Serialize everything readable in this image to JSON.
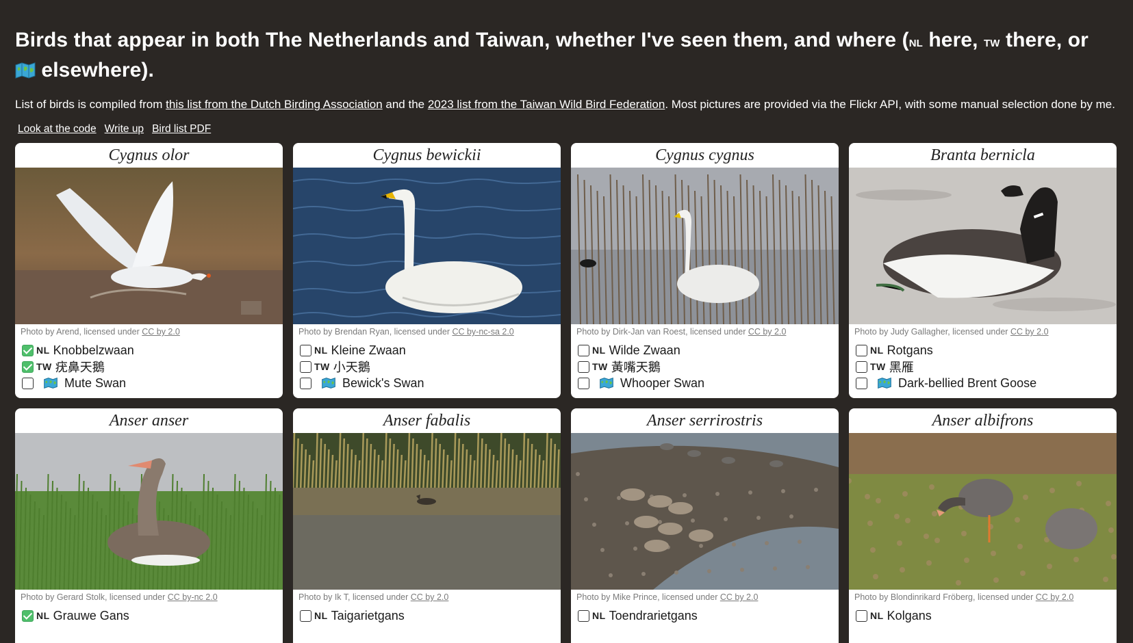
{
  "header": {
    "title_part1": "Birds that appear in both The Netherlands and Taiwan, whether I've seen them, and where (",
    "nl_tag": "NL",
    "title_part2": " here, ",
    "tw_tag": "TW",
    "title_part3": " there, or",
    "title_part4": " elsewhere)."
  },
  "intro": {
    "t1": "List of birds is compiled from ",
    "link1": "this list from the Dutch Birding Association",
    "t2": " and the ",
    "link2": "2023 list from the Taiwan Wild Bird Federation",
    "t3": ". Most pictures are provided via the Flickr API, with some manual selection done by me."
  },
  "links": {
    "code": "Look at the code",
    "writeup": "Write up",
    "pdf": "Bird list PDF"
  },
  "tags": {
    "nl": "NL",
    "tw": "TW"
  },
  "colors": {
    "background": "#2b2724",
    "check_green": "#4fbf6b",
    "card": "#ffffff"
  },
  "cards": [
    {
      "latin": "Cygnus olor",
      "credit_prefix": "Photo by Arend, licensed under ",
      "license": "CC by 2.0",
      "nl_name": "Knobbelzwaan",
      "tw_name": "疣鼻天鵝",
      "en_name": "Mute Swan",
      "nl_checked": true,
      "tw_checked": true,
      "en_checked": false
    },
    {
      "latin": "Cygnus bewickii",
      "credit_prefix": "Photo by Brendan Ryan, licensed under ",
      "license": "CC by-nc-sa 2.0",
      "nl_name": "Kleine Zwaan",
      "tw_name": "小天鵝",
      "en_name": "Bewick's Swan",
      "nl_checked": false,
      "tw_checked": false,
      "en_checked": false
    },
    {
      "latin": "Cygnus cygnus",
      "credit_prefix": "Photo by Dirk-Jan van Roest, licensed under ",
      "license": "CC by 2.0",
      "nl_name": "Wilde Zwaan",
      "tw_name": "黃嘴天鵝",
      "en_name": "Whooper Swan",
      "nl_checked": false,
      "tw_checked": false,
      "en_checked": false
    },
    {
      "latin": "Branta bernicla",
      "credit_prefix": "Photo by Judy Gallagher, licensed under ",
      "license": "CC by 2.0",
      "nl_name": "Rotgans",
      "tw_name": "黑雁",
      "en_name": "Dark-bellied Brent Goose",
      "nl_checked": false,
      "tw_checked": false,
      "en_checked": false
    },
    {
      "latin": "Anser anser",
      "credit_prefix": "Photo by Gerard Stolk, licensed under ",
      "license": "CC by-nc 2.0",
      "nl_name": "Grauwe Gans",
      "nl_checked": true
    },
    {
      "latin": "Anser fabalis",
      "credit_prefix": "Photo by Ik T, licensed under ",
      "license": "CC by 2.0",
      "nl_name": "Taigarietgans",
      "nl_checked": false
    },
    {
      "latin": "Anser serrirostris",
      "credit_prefix": "Photo by Mike Prince, licensed under ",
      "license": "CC by 2.0",
      "nl_name": "Toendrarietgans",
      "nl_checked": false
    },
    {
      "latin": "Anser albifrons",
      "credit_prefix": "Photo by Blondinrikard Fröberg, licensed under ",
      "license": "CC by 2.0",
      "nl_name": "Kolgans",
      "nl_checked": false
    }
  ]
}
